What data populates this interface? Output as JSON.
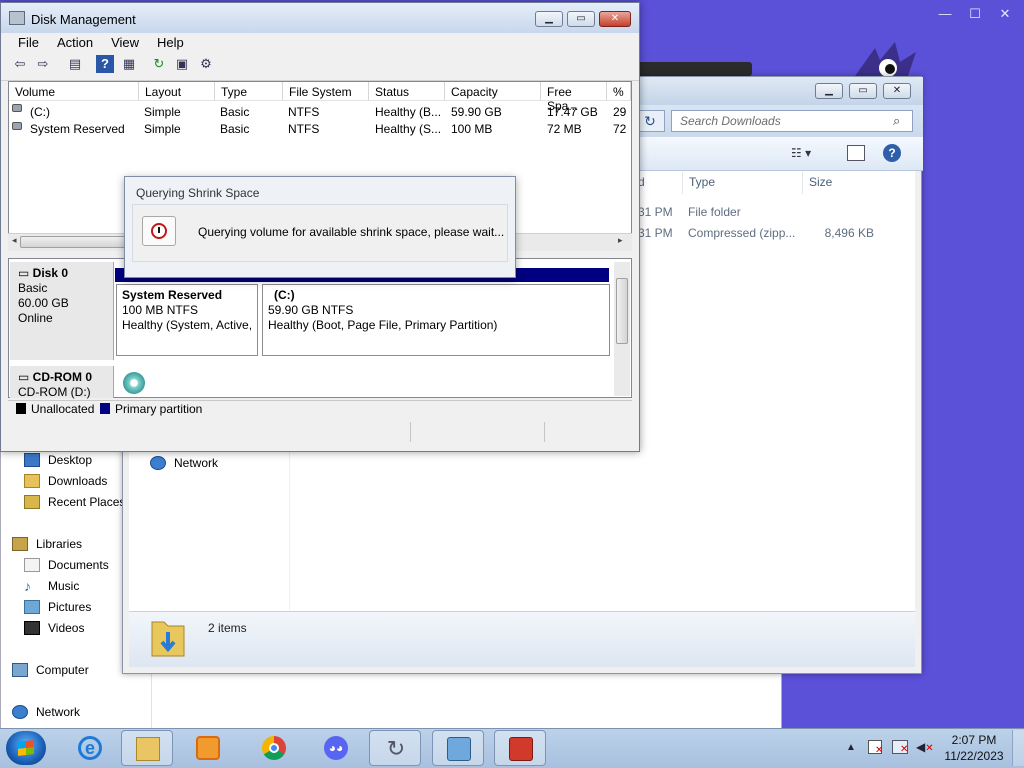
{
  "top_caption": {
    "min": "—",
    "max": "☐",
    "close": "✕"
  },
  "explorer_back": {
    "nav": [
      {
        "label": "Desktop"
      },
      {
        "label": "Downloads"
      },
      {
        "label": "Recent Places"
      },
      {
        "label": "Libraries"
      },
      {
        "label": "Documents"
      },
      {
        "label": "Music"
      },
      {
        "label": "Pictures"
      },
      {
        "label": "Videos"
      },
      {
        "label": "Computer"
      },
      {
        "label": "Network"
      }
    ]
  },
  "explorer_front": {
    "search_placeholder": "Search Downloads",
    "columns": {
      "date_frag": "d",
      "type": "Type",
      "size": "Size"
    },
    "rows": [
      {
        "date_frag": "31 PM",
        "type": "File folder",
        "size": ""
      },
      {
        "date_frag": "31 PM",
        "type": "Compressed (zipp...",
        "size": "8,496 KB"
      }
    ],
    "network_label": "Network",
    "status_items": "2 items"
  },
  "disk_mgmt": {
    "title": "Disk Management",
    "menu": [
      "File",
      "Action",
      "View",
      "Help"
    ],
    "columns": [
      "Volume",
      "Layout",
      "Type",
      "File System",
      "Status",
      "Capacity",
      "Free Spa...",
      "% F"
    ],
    "volumes": [
      {
        "volume": "(C:)",
        "layout": "Simple",
        "type": "Basic",
        "fs": "NTFS",
        "status": "Healthy (B...",
        "capacity": "59.90 GB",
        "free": "17.47 GB",
        "pct": "29"
      },
      {
        "volume": "System Reserved",
        "layout": "Simple",
        "type": "Basic",
        "fs": "NTFS",
        "status": "Healthy (S...",
        "capacity": "100 MB",
        "free": "72 MB",
        "pct": "72"
      }
    ],
    "disk0": {
      "name": "Disk 0",
      "kind": "Basic",
      "size": "60.00 GB",
      "state": "Online"
    },
    "partitions": [
      {
        "name": "System Reserved",
        "size": "100 MB NTFS",
        "status": "Healthy (System, Active,"
      },
      {
        "name": "(C:)",
        "size": "59.90 GB NTFS",
        "status": "Healthy (Boot, Page File, Primary Partition)"
      }
    ],
    "cdrom": {
      "name": "CD-ROM 0",
      "drive": "CD-ROM (D:)"
    },
    "legend": [
      {
        "label": "Unallocated",
        "color": "#000000"
      },
      {
        "label": "Primary partition",
        "color": "#000080"
      }
    ]
  },
  "query_dialog": {
    "title": "Querying Shrink Space",
    "message": "Querying volume for available shrink space, please wait..."
  },
  "taskbar": {
    "apps": [
      "internet-explorer",
      "file-explorer",
      "media-player",
      "chrome",
      "discord",
      "sync",
      "control-panel",
      "toolbox"
    ],
    "time": "2:07 PM",
    "date": "11/22/2023"
  }
}
